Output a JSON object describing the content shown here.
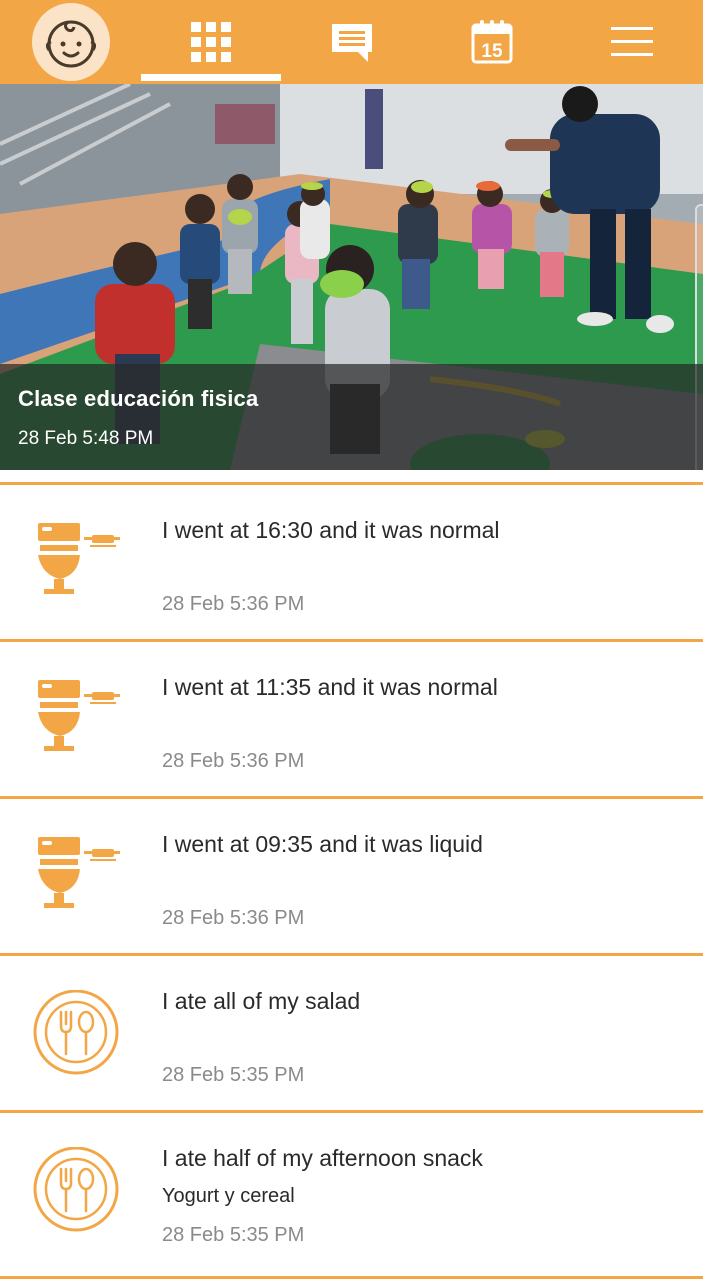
{
  "colors": {
    "accent": "#f3a646",
    "avatar_bg": "#fbe3c8",
    "text": "#2a2a2a",
    "muted": "#8a8a8a"
  },
  "nav": {
    "items": [
      {
        "icon": "baby-face-icon"
      },
      {
        "icon": "grid-icon",
        "active": true
      },
      {
        "icon": "chat-icon"
      },
      {
        "icon": "calendar-icon",
        "calendar_day": "15"
      },
      {
        "icon": "hamburger-menu-icon"
      }
    ]
  },
  "hero": {
    "title": "Clase educación fisica",
    "time": "28 Feb 5:48 PM"
  },
  "feed": [
    {
      "icon": "toilet-icon",
      "title": "I went at 16:30 and it was normal",
      "time": "28 Feb 5:36 PM"
    },
    {
      "icon": "toilet-icon",
      "title": "I went at 11:35 and it was normal",
      "time": "28 Feb 5:36 PM"
    },
    {
      "icon": "toilet-icon",
      "title": "I went at 09:35 and it was liquid",
      "time": "28 Feb 5:36 PM"
    },
    {
      "icon": "meal-icon",
      "title": "I ate all of my salad",
      "time": "28 Feb 5:35 PM"
    },
    {
      "icon": "meal-icon",
      "title": "I ate half of my afternoon snack",
      "subtitle": "Yogurt y cereal",
      "time": "28 Feb 5:35 PM"
    }
  ]
}
